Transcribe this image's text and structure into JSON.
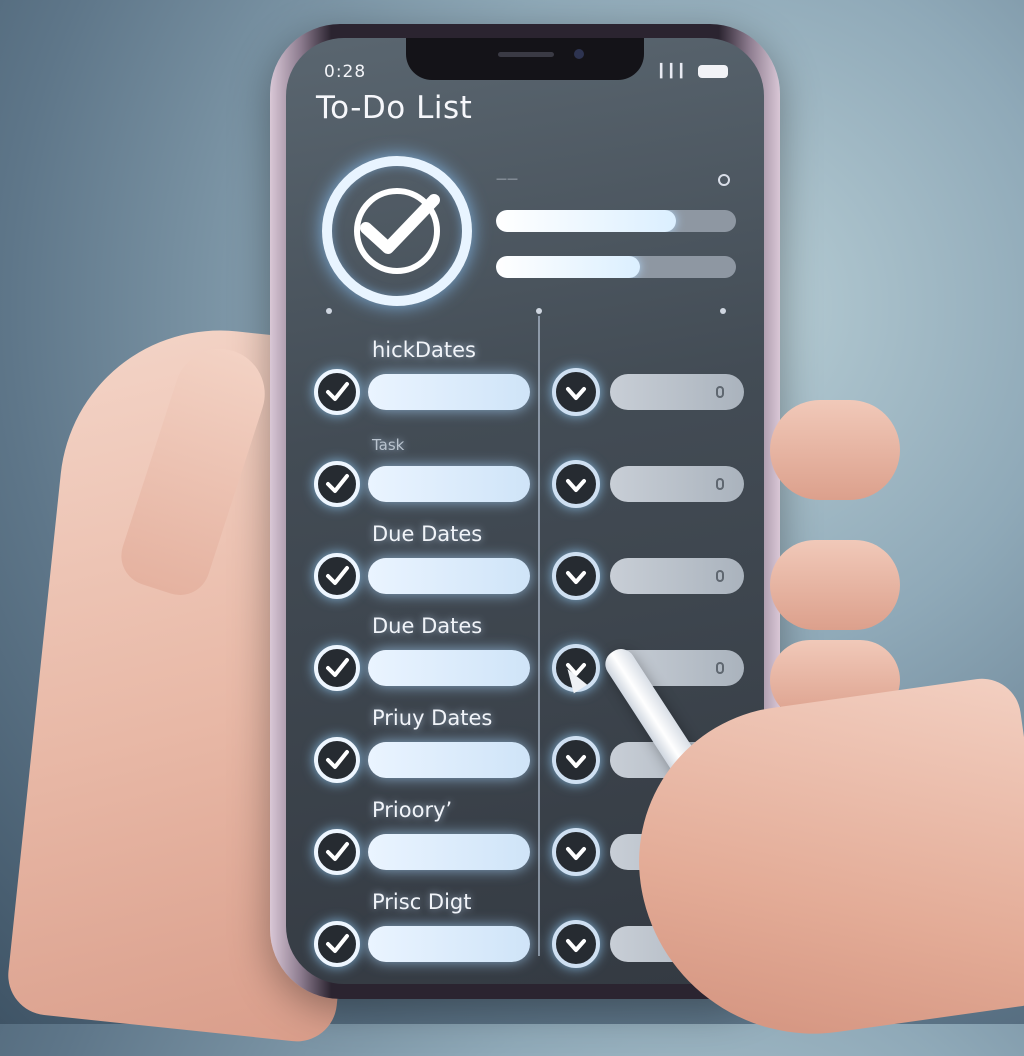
{
  "status_bar": {
    "time": "0:28",
    "signal": "▎▎▎"
  },
  "app": {
    "title": "To-Do List"
  },
  "header": {
    "label": "——"
  },
  "tasks": [
    {
      "label": "hickDates",
      "small": false
    },
    {
      "label": "Task",
      "small": true
    },
    {
      "label": "Due Dates",
      "small": false
    },
    {
      "label": "Due Dates",
      "small": false
    },
    {
      "label": "Priuy Dates",
      "small": false
    },
    {
      "label": "Prioory’",
      "small": false
    },
    {
      "label": "Prisc Digt",
      "small": false
    }
  ],
  "colors": {
    "accent": "#eaf4ff",
    "screen": "#434c55",
    "glow": "#8ccbff"
  },
  "icons": {
    "big_check": "check-circle-icon",
    "task_check": "check-circle-icon",
    "battery": "battery-icon",
    "stylus": "stylus-icon",
    "plant": "plant-icon"
  }
}
